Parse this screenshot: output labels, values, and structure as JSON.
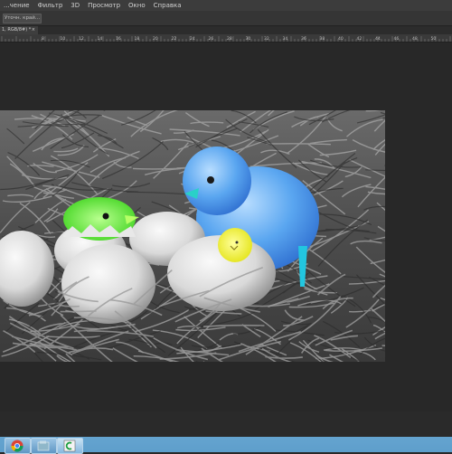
{
  "menubar": {
    "items": [
      "...чение",
      "Фильтр",
      "3D",
      "Просмотр",
      "Окно",
      "Справка"
    ]
  },
  "options": {
    "button_label": "Уточн. край..."
  },
  "document": {
    "tab_title": "1, RGB/8#) *",
    "close_glyph": "×"
  },
  "ruler": {
    "ticks": [
      "8",
      "10",
      "12",
      "14",
      "16",
      "18",
      "20",
      "22",
      "24",
      "26",
      "28",
      "30",
      "32",
      "34",
      "36",
      "38",
      "40",
      "42",
      "44",
      "46",
      "48",
      "50"
    ]
  },
  "taskbar": {
    "apps": [
      "chrome-app",
      "explorer-app",
      "photoshop-app"
    ]
  }
}
